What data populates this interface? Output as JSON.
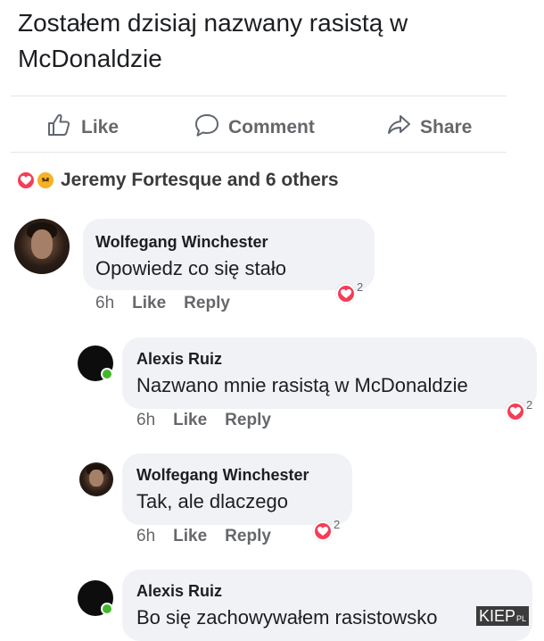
{
  "post": {
    "text": "Zostałem dzisiaj nazwany rasistą w McDonaldzie"
  },
  "actions": [
    {
      "label": "Like",
      "icon": "thumbs-up-icon"
    },
    {
      "label": "Comment",
      "icon": "comment-icon"
    },
    {
      "label": "Share",
      "icon": "share-icon"
    }
  ],
  "reactions": {
    "summary": "Jeremy Fortesque and 6 others",
    "icons": [
      "heart-reaction-icon",
      "sad-reaction-icon"
    ]
  },
  "comments": [
    {
      "author": "Wolfegang Winchester",
      "text": "Opowiedz co się stało",
      "time": "6h",
      "like": "Like",
      "reply": "Reply",
      "reaction_count": "2"
    },
    {
      "author": "Alexis Ruiz",
      "text": "Nazwano mnie rasistą w McDonaldzie",
      "time": "6h",
      "like": "Like",
      "reply": "Reply",
      "reaction_count": "2"
    },
    {
      "author": "Wolfegang Winchester",
      "text": "Tak, ale dlaczego",
      "time": "6h",
      "like": "Like",
      "reply": "Reply",
      "reaction_count": "2"
    },
    {
      "author": "Alexis Ruiz",
      "text": "Bo się zachowywałem rasistowsko"
    }
  ],
  "watermark": {
    "main": "KIEP",
    "suffix": "PL"
  },
  "colors": {
    "heart": "#f33e58",
    "sad": "#f7b125",
    "online": "#42b72a",
    "bubble": "#f0f2f5",
    "muted": "#65676b"
  }
}
